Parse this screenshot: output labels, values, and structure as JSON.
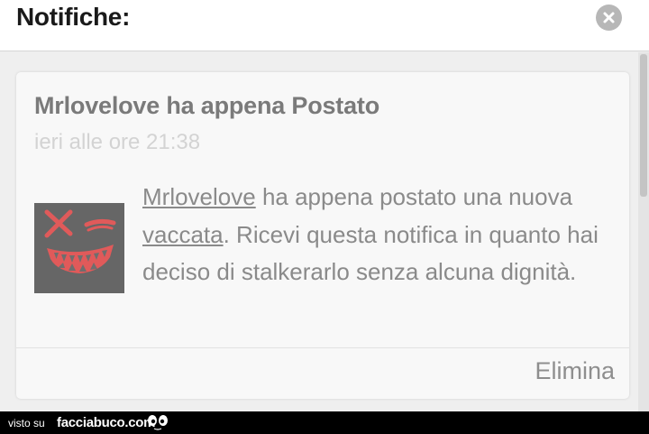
{
  "header": {
    "title": "Notifiche:",
    "close_icon": "close-icon"
  },
  "notification": {
    "title": "Mrlovelove ha appena Postato",
    "time": "ieri alle ore 21:38",
    "message": {
      "user_link": "Mrlovelove",
      "text_1": " ha appena postato una nuova ",
      "post_link": "vaccata",
      "text_2": ". Ricevi questa notifica in quanto hai deciso di stalkerarlo senza alcuna dignità."
    },
    "delete_label": "Elimina"
  },
  "watermark": {
    "prefix": "visto su",
    "site": "facciabuco.com"
  },
  "colors": {
    "accent_avatar_face": "#e05a5a",
    "header_background": "#ffffff",
    "panel_background": "#efefef",
    "card_background": "#f8f8f8",
    "text_muted": "#8a8a8a"
  }
}
